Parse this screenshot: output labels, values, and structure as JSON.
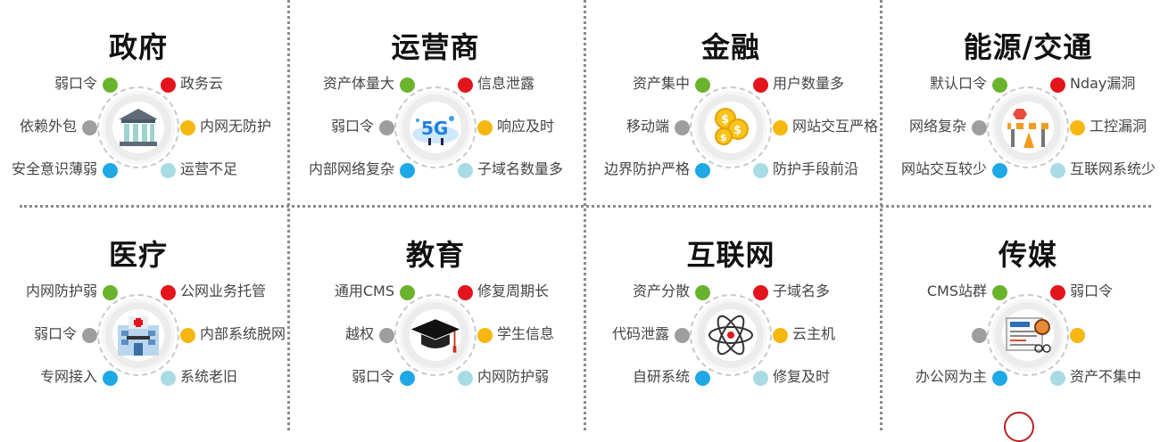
{
  "colors": {
    "green": "#6ab42d",
    "red": "#e3141b",
    "yellow": "#f6b70f",
    "gray": "#9e9e9e",
    "blue": "#1ea8e6",
    "light_blue": "#a8dbe4"
  },
  "sectors": [
    {
      "title": "政府",
      "icon": "government-building-icon",
      "items": {
        "tl": "弱口令",
        "tr": "政务云",
        "ml": "依赖外包",
        "mr": "内网无防护",
        "bl": "安全意识薄弱",
        "br": "运营不足"
      }
    },
    {
      "title": "运营商",
      "icon": "5g-network-icon",
      "items": {
        "tl": "资产体量大",
        "tr": "信息泄露",
        "ml": "弱口令",
        "mr": "响应及时",
        "bl": "内部网络复杂",
        "br": "子域名数量多"
      }
    },
    {
      "title": "金融",
      "icon": "gold-coins-icon",
      "items": {
        "tl": "资产集中",
        "tr": "用户数量多",
        "ml": "移动端",
        "mr": "网站交互严格",
        "bl": "边界防护严格",
        "br": "防护手段前沿"
      }
    },
    {
      "title": "能源/交通",
      "icon": "road-barrier-icon",
      "items": {
        "tl": "默认口令",
        "tr": "Nday漏洞",
        "ml": "网络复杂",
        "mr": "工控漏洞",
        "bl": "网站交互较少",
        "br": "互联网系统少"
      }
    },
    {
      "title": "医疗",
      "icon": "hospital-icon",
      "items": {
        "tl": "内网防护弱",
        "tr": "公网业务托管",
        "ml": "弱口令",
        "mr": "内部系统脱网",
        "bl": "专网接入",
        "br": "系统老旧"
      }
    },
    {
      "title": "教育",
      "icon": "graduation-cap-icon",
      "items": {
        "tl": "通用CMS",
        "tr": "修复周期长",
        "ml": "越权",
        "mr": "学生信息",
        "bl": "弱口令",
        "br": "内网防护弱"
      }
    },
    {
      "title": "互联网",
      "icon": "atom-icon",
      "items": {
        "tl": "资产分散",
        "tr": "子域名多",
        "ml": "代码泄露",
        "mr": "云主机",
        "bl": "自研系统",
        "br": "修复及时"
      }
    },
    {
      "title": "传媒",
      "icon": "newspaper-icon",
      "items": {
        "tl": "CMS站群",
        "tr": "弱口令",
        "ml": "",
        "mr": "",
        "bl": "办公网为主",
        "br": "资产不集中"
      }
    }
  ]
}
